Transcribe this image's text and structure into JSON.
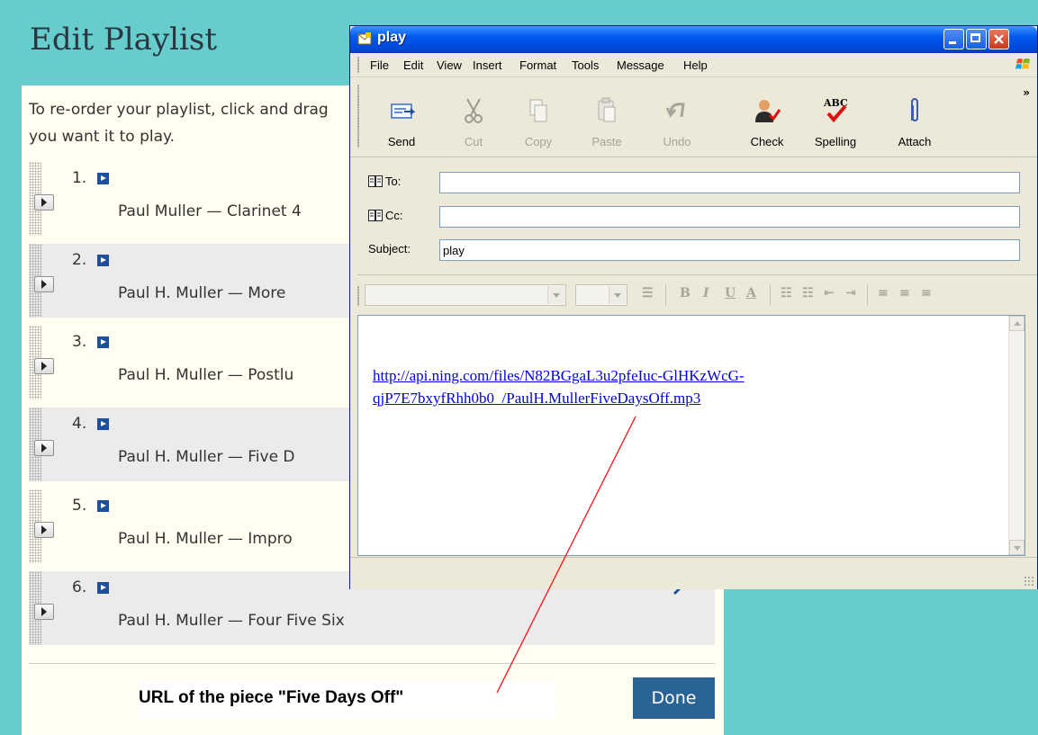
{
  "playlist": {
    "title": "Edit Playlist",
    "instructions_line1": "To re-order your playlist, click and drag",
    "instructions_line2": "you want it to play.",
    "tracks": [
      {
        "num": "1.",
        "title": "Paul Muller — Clarinet 4"
      },
      {
        "num": "2.",
        "title": "Paul H. Muller — More"
      },
      {
        "num": "3.",
        "title": "Paul H. Muller — Postlu"
      },
      {
        "num": "4.",
        "title": "Paul H. Muller — Five D"
      },
      {
        "num": "5.",
        "title": "Paul H. Muller — Impro"
      },
      {
        "num": "6.",
        "title": "Paul H. Muller — Four Five Six"
      }
    ],
    "done_label": "Done",
    "caption": "URL of the piece \"Five Days Off\""
  },
  "window": {
    "title": "play",
    "menu": [
      "File",
      "Edit",
      "View",
      "Insert",
      "Format",
      "Tools",
      "Message",
      "Help"
    ],
    "toolbar": [
      {
        "label": "Send",
        "icon": "send-icon",
        "enabled": true
      },
      {
        "label": "Cut",
        "icon": "scissors-icon",
        "enabled": false
      },
      {
        "label": "Copy",
        "icon": "copy-icon",
        "enabled": false
      },
      {
        "label": "Paste",
        "icon": "paste-icon",
        "enabled": false
      },
      {
        "label": "Undo",
        "icon": "undo-icon",
        "enabled": false
      },
      {
        "label": "Check",
        "icon": "check-names-icon",
        "enabled": true
      },
      {
        "label": "Spelling",
        "icon": "spelling-icon",
        "enabled": true
      },
      {
        "label": "Attach",
        "icon": "paperclip-icon",
        "enabled": true
      }
    ],
    "fields": {
      "to_label": "To:",
      "to_value": "",
      "cc_label": "Cc:",
      "cc_value": "",
      "subject_label": "Subject:",
      "subject_value": "play"
    },
    "body_link_line1": "http://api.ning.com/files/N82BGgaL3u2pfeIuc-GlHKzWcG-",
    "body_link_line2": "qjP7E7bxyfRhh0b0_/PaulH.MullerFiveDaysOff.mp3",
    "spelling_icon_text": "ABC"
  },
  "colors": {
    "page_bg": "#66cccc",
    "panel_bg": "#fffef0",
    "done_button": "#2a6496",
    "link": "#0000ee",
    "xp_title": "#0058ee",
    "pointer_line": "#ff0000"
  }
}
